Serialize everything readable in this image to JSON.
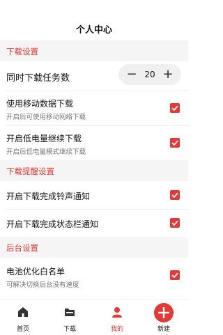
{
  "header": {
    "title": "个人中心"
  },
  "sections": {
    "download": "下载设置",
    "reminder": "下载提醒设置",
    "background": "后台设置"
  },
  "settings": {
    "concurrent": {
      "label": "同时下载任务数",
      "value": "20",
      "minus": "−",
      "plus": "+"
    },
    "mobile_data": {
      "label": "使用移动数据下载",
      "sub": "开启后可使用移动网络下载",
      "checked": true
    },
    "low_battery": {
      "label": "开启低电量继续下载",
      "sub": "开启后低电量模式继续下载",
      "checked": true
    },
    "ringtone": {
      "label": "开启下载完成铃声通知",
      "checked": true
    },
    "statusbar": {
      "label": "开启下载完成状态栏通知",
      "checked": true
    },
    "battery_whitelist": {
      "label": "电池优化白名单",
      "sub": "可解决切换后台没有速度",
      "checked": true
    }
  },
  "tabbar": {
    "items": [
      {
        "label": "首页",
        "icon": "home-icon"
      },
      {
        "label": "下载",
        "icon": "folder-icon"
      },
      {
        "label": "我的",
        "icon": "user-icon",
        "active": true
      },
      {
        "label": "新建",
        "icon": "plus-icon"
      }
    ]
  },
  "colors": {
    "accent": "#e53935",
    "section_bg": "#f5f5f5"
  }
}
